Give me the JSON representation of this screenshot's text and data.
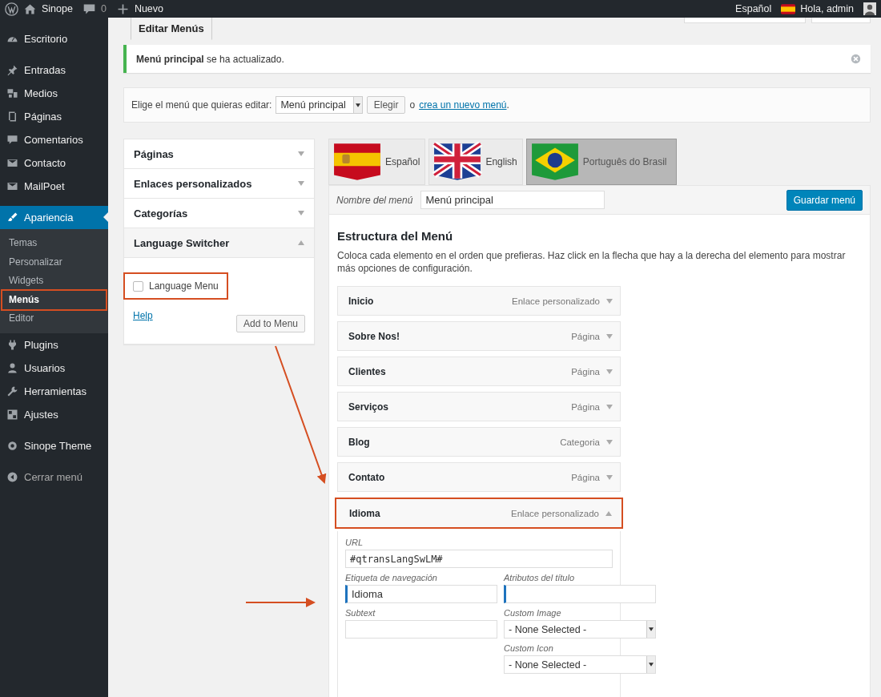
{
  "admin_bar": {
    "site": "Sinope",
    "comments": "0",
    "new": "Nuevo",
    "language": "Español",
    "greeting": "Hola, admin"
  },
  "sidebar": {
    "groups": [
      {
        "items": [
          {
            "label": "Escritorio",
            "selected": false
          }
        ]
      },
      {
        "items": [
          {
            "label": "Entradas",
            "selected": false
          },
          {
            "label": "Medios",
            "selected": false
          },
          {
            "label": "Páginas",
            "selected": false
          },
          {
            "label": "Comentarios",
            "selected": false
          },
          {
            "label": "Contacto",
            "selected": false
          },
          {
            "label": "MailPoet",
            "selected": false
          }
        ]
      },
      {
        "items": [
          {
            "label": "Apariencia",
            "selected": true,
            "children": [
              {
                "label": "Temas",
                "selected": false,
                "highlighted": false
              },
              {
                "label": "Personalizar",
                "selected": false,
                "highlighted": false
              },
              {
                "label": "Widgets",
                "selected": false,
                "highlighted": false
              },
              {
                "label": "Menús",
                "selected": true,
                "highlighted": true
              },
              {
                "label": "Editor",
                "selected": false,
                "highlighted": false
              }
            ]
          },
          {
            "label": "Plugins",
            "selected": false
          },
          {
            "label": "Usuarios",
            "selected": false
          },
          {
            "label": "Herramientas",
            "selected": false
          },
          {
            "label": "Ajustes",
            "selected": false
          }
        ]
      },
      {
        "items": [
          {
            "label": "Sinope Theme",
            "selected": false
          }
        ]
      }
    ],
    "collapse": "Cerrar menú"
  },
  "tabs": [
    {
      "label": "Editar Menús",
      "selected": true
    }
  ],
  "notice": "**Menú principal** se ha actualizado.",
  "menu_select": {
    "label": "Elige el menú que quieras editar:",
    "value": "Menú principal",
    "button": "Elegir",
    "separator": "o",
    "link": "crea un nuevo menú",
    "after": "."
  },
  "add_items": [
    {
      "title": "Páginas",
      "expanded": false
    },
    {
      "title": "Enlaces personalizados",
      "expanded": false
    },
    {
      "title": "Categorías",
      "expanded": false
    },
    {
      "title": "Language Switcher",
      "expanded": true,
      "checkbox": {
        "label": "Language Menu",
        "checked": false,
        "highlighted": true
      },
      "help": "Help",
      "button": "Add to Menu"
    }
  ],
  "language_tabs": [
    {
      "label": "Español",
      "kind": "es",
      "selected": false
    },
    {
      "label": "English",
      "kind": "gb",
      "selected": false
    },
    {
      "label": "Português do Brasil",
      "kind": "br",
      "selected": true
    }
  ],
  "menu_name": {
    "label": "Nombre del menú",
    "value": "Menú principal"
  },
  "save_button": "Guardar menú",
  "structure": {
    "title": "Estructura del Menú",
    "description": "Coloca cada elemento en el orden que prefieras. Haz click en la flecha que hay a la derecha del elemento para mostrar más opciones de configuración.",
    "items": [
      {
        "title": "Inicio",
        "type": "Enlace personalizado",
        "expanded": false,
        "highlighted": false
      },
      {
        "title": "Sobre Nos!",
        "type": "Página",
        "expanded": false,
        "highlighted": false
      },
      {
        "title": "Clientes",
        "type": "Página",
        "expanded": false,
        "highlighted": false
      },
      {
        "title": "Serviços",
        "type": "Página",
        "expanded": false,
        "highlighted": false
      },
      {
        "title": "Blog",
        "type": "Categoria",
        "expanded": false,
        "highlighted": false
      },
      {
        "title": "Contato",
        "type": "Página",
        "expanded": false,
        "highlighted": false
      },
      {
        "title": "Idioma",
        "type": "Enlace personalizado",
        "expanded": true,
        "highlighted": true,
        "settings": {
          "url": {
            "label": "URL",
            "value": "#qtransLangSwLM#"
          },
          "left": [
            {
              "label": "Etiqueta de navegación",
              "value": "Idioma",
              "kind": "translatable"
            },
            {
              "label": "Subtext",
              "kind": "text"
            }
          ],
          "right": [
            {
              "label": "Atributos del título",
              "kind": "translatable"
            },
            {
              "label": "Custom Image",
              "value": "- None Selected -",
              "kind": "select"
            },
            {
              "label": "Custom Icon",
              "value": "- None Selected -",
              "kind": "select"
            }
          ]
        }
      }
    ]
  }
}
